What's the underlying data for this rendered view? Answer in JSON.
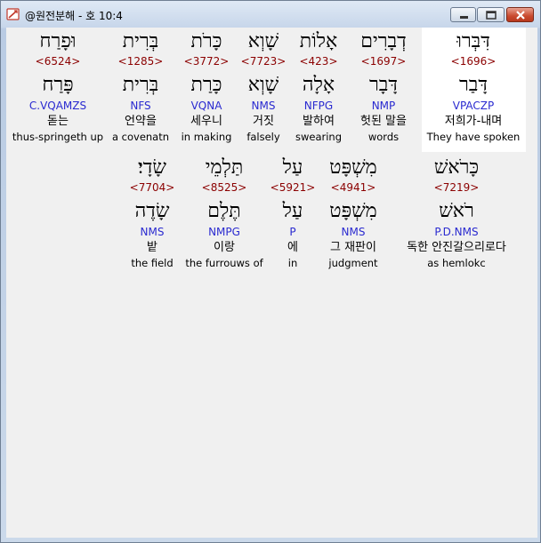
{
  "window": {
    "title": "@원전분해 - 호 10:4",
    "icon": "bible-app-icon",
    "controls": {
      "minimize": "minimize-icon",
      "maximize": "maximize-icon",
      "close": "close-icon"
    }
  },
  "colors": {
    "strong": "#8b0000",
    "morph": "#2a2ad0",
    "highlight": "#ffffff"
  },
  "words": [
    {
      "heb": "דִּבְּרוּ",
      "strong": "<1696>",
      "lemma": "דָּבַר",
      "morph": "VPACZP",
      "kor": "저희가-내며",
      "eng": "They have spoken"
    },
    {
      "heb": "דְבָרִים",
      "strong": "<1697>",
      "lemma": "דָּבָר",
      "morph": "NMP",
      "kor": "헛된 말을",
      "eng": "words"
    },
    {
      "heb": "אָלוֹת",
      "strong": "<423>",
      "lemma": "אָלָה",
      "morph": "NFPG",
      "kor": "발하여",
      "eng": "swearing"
    },
    {
      "heb": "שָׁוְא",
      "strong": "<7723>",
      "lemma": "שָׁוְא",
      "morph": "NMS",
      "kor": "거짓",
      "eng": "falsely"
    },
    {
      "heb": "כָּרֹת",
      "strong": "<3772>",
      "lemma": "כָּרַת",
      "morph": "VQNA",
      "kor": "세우니",
      "eng": "in making"
    },
    {
      "heb": "בְּרִית",
      "strong": "<1285>",
      "lemma": "בְּרִית",
      "morph": "NFS",
      "kor": "언약을",
      "eng": "a covenatn"
    },
    {
      "heb": "וּפָרַח",
      "strong": "<6524>",
      "lemma": "פָּרַח",
      "morph": "C.VQAMZS",
      "kor": "돋는",
      "eng": "thus-springeth up"
    },
    {
      "heb": "כָּרֹאשׁ",
      "strong": "<7219>",
      "lemma": "רֹאשׁ",
      "morph": "P.D.NMS",
      "kor": "독한 안진갈으리로다",
      "eng": "as hemlokc"
    },
    {
      "heb": "מִשְׁפָּט",
      "strong": "<4941>",
      "lemma": "מִשְׁפָּט",
      "morph": "NMS",
      "kor": "그 재판이",
      "eng": "judgment"
    },
    {
      "heb": "עַל",
      "strong": "<5921>",
      "lemma": "עַל",
      "morph": "P",
      "kor": "에",
      "eng": "in"
    },
    {
      "heb": "תַּלְמֵי",
      "strong": "<8525>",
      "lemma": "תֶּלֶם",
      "morph": "NMPG",
      "kor": "이랑",
      "eng": "the furrouws of"
    },
    {
      "heb": "שָׂדָי׃",
      "strong": "<7704>",
      "lemma": "שָׂדֶה",
      "morph": "NMS",
      "kor": "밭",
      "eng": "the field"
    }
  ]
}
